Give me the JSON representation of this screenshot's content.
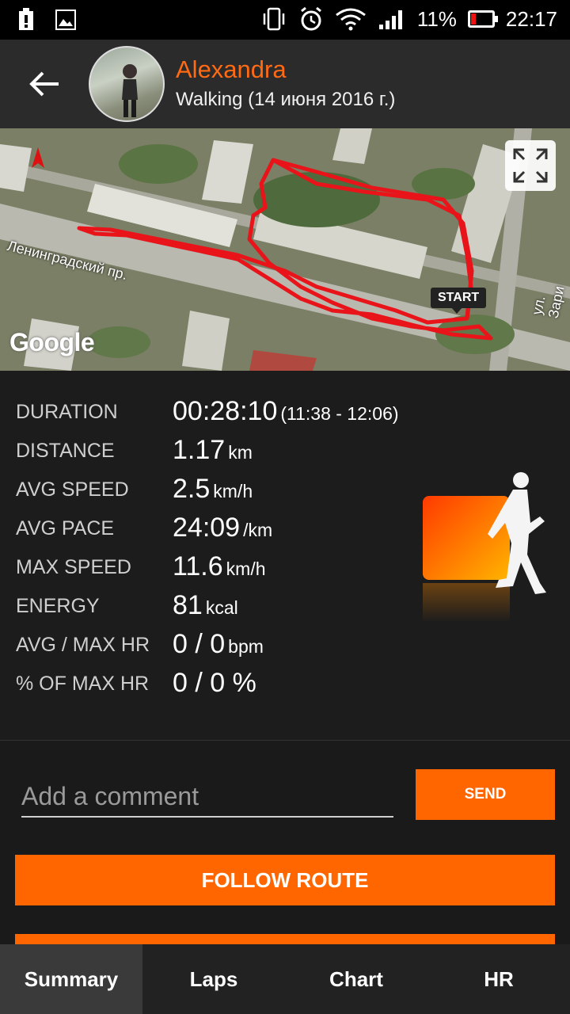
{
  "status_bar": {
    "battery_percent": "11%",
    "time": "22:17",
    "icons": [
      "notification-icon",
      "image-icon",
      "vibrate-icon",
      "alarm-icon",
      "wifi-icon",
      "signal-icon",
      "battery-icon"
    ]
  },
  "header": {
    "user_name": "Alexandra",
    "activity": "Walking (14 июня 2016 г.)"
  },
  "map": {
    "start_label": "START",
    "street_1": "Ленинградский пр.",
    "street_2": "ул. Зари",
    "provider": "Google",
    "route_color": "#e8141a"
  },
  "stats": [
    {
      "label": "DURATION",
      "value": "00:28:10",
      "unit": "(11:38 - 12:06)"
    },
    {
      "label": "DISTANCE",
      "value": "1.17",
      "unit": "km"
    },
    {
      "label": "AVG SPEED",
      "value": "2.5",
      "unit": "km/h"
    },
    {
      "label": "AVG PACE",
      "value": "24:09",
      "unit": "/km"
    },
    {
      "label": "MAX SPEED",
      "value": "11.6",
      "unit": "km/h"
    },
    {
      "label": "ENERGY",
      "value": "81",
      "unit": "kcal"
    },
    {
      "label": "AVG / MAX HR",
      "value": "0 / 0",
      "unit": "bpm"
    },
    {
      "label": "% OF MAX HR",
      "value": "0 / 0 %",
      "unit": ""
    }
  ],
  "comment": {
    "placeholder": "Add a comment",
    "send_label": "SEND"
  },
  "actions": {
    "follow_route": "FOLLOW ROUTE"
  },
  "tabs": [
    {
      "label": "Summary",
      "active": true
    },
    {
      "label": "Laps",
      "active": false
    },
    {
      "label": "Chart",
      "active": false
    },
    {
      "label": "HR",
      "active": false
    }
  ],
  "colors": {
    "accent": "#ff6600",
    "name": "#ff6a13"
  }
}
